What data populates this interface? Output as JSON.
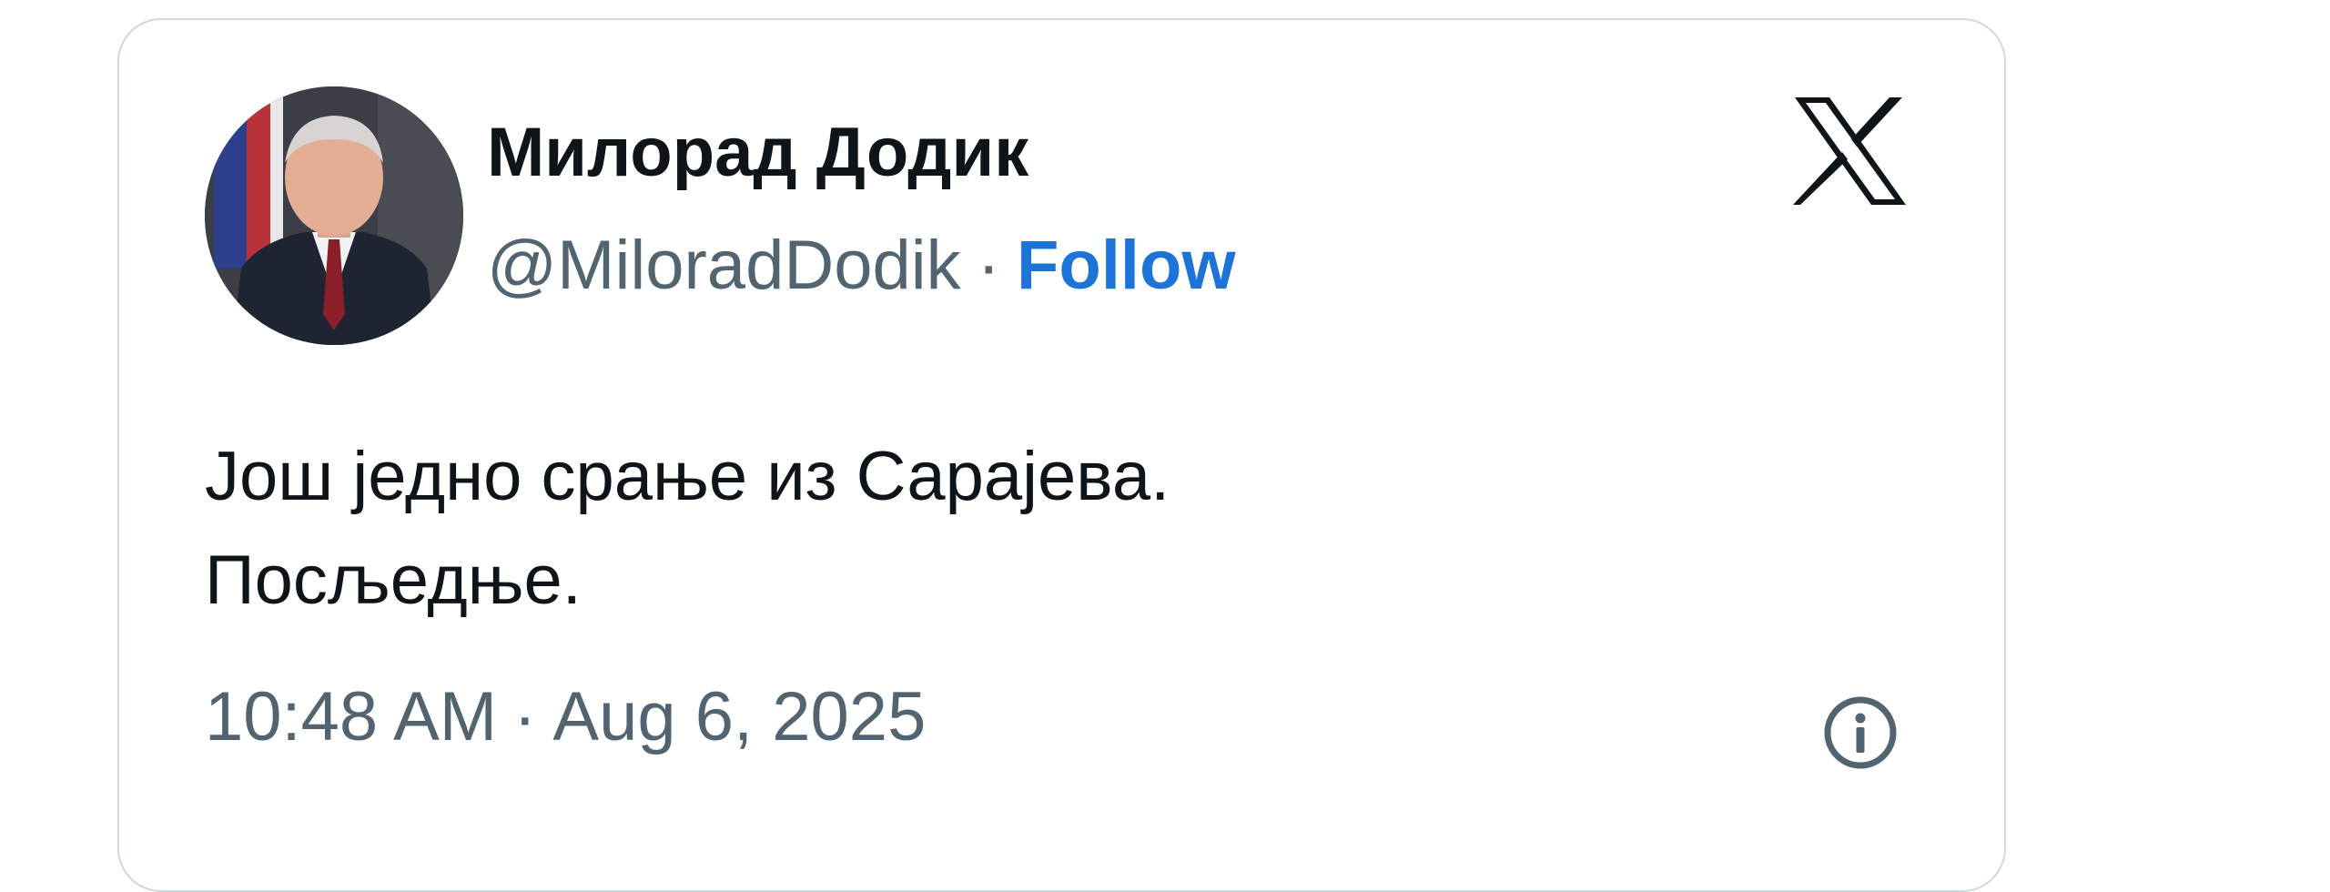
{
  "tweet": {
    "author_name": "Милорад Додик",
    "handle": "@MiloradDodik",
    "separator": "·",
    "follow_label": "Follow",
    "text_lines": [
      "Још једно срање из Сарајева.",
      "Посљедње."
    ],
    "time": "10:48 AM",
    "date": "Aug 6, 2025"
  },
  "icons": {
    "brand": "x-logo-icon",
    "info": "info-icon"
  },
  "colors": {
    "follow": "#1d74d8",
    "secondary_text": "#536471",
    "primary_text": "#0f1419",
    "card_border": "#cfd9de"
  }
}
